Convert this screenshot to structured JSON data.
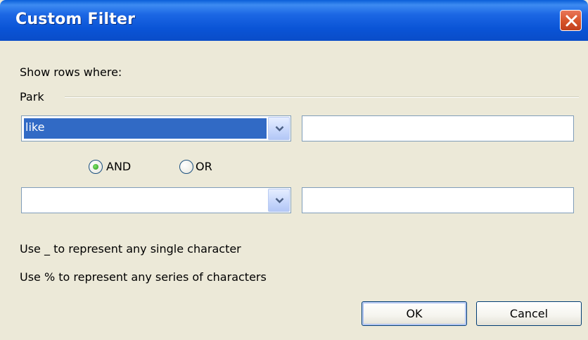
{
  "window": {
    "title": "Custom Filter"
  },
  "intro": "Show rows where:",
  "group": {
    "label": "Park"
  },
  "condition1": {
    "operator": "like",
    "value": ""
  },
  "logic": {
    "and_label": "AND",
    "or_label": "OR",
    "selected": "AND"
  },
  "condition2": {
    "operator": "",
    "value": ""
  },
  "hints": [
    "Use _ to represent any single character",
    "Use % to represent any series of characters"
  ],
  "buttons": {
    "ok": "OK",
    "cancel": "Cancel"
  },
  "colors": {
    "titlebar": "#0a54d6",
    "selection": "#316ac5",
    "background": "#ece9d8"
  }
}
